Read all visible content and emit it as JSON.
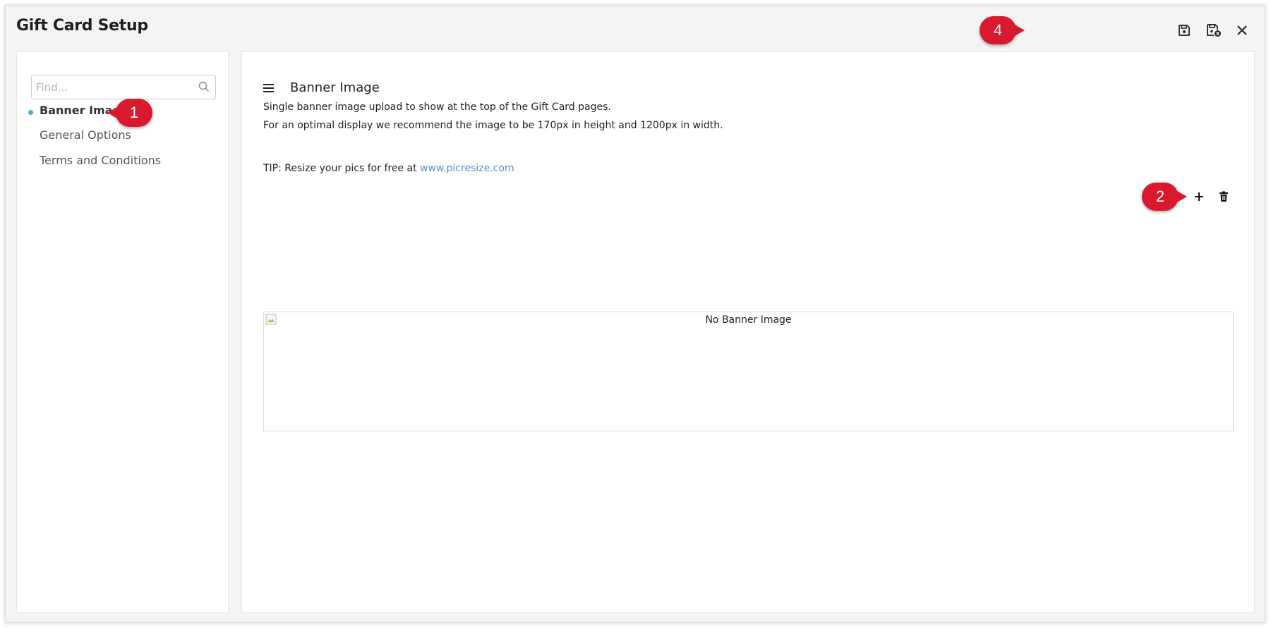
{
  "window": {
    "title": "Gift Card Setup",
    "actions": {
      "save_icon": "save-icon",
      "save_cancel_icon": "save-cancel-icon",
      "close_icon": "close-icon"
    }
  },
  "callouts": {
    "sidebar": "1",
    "add": "2",
    "save": "4"
  },
  "sidebar": {
    "search": {
      "placeholder": "Find...",
      "value": ""
    },
    "items": [
      {
        "label": "Banner Image",
        "active": true
      },
      {
        "label": "General Options",
        "active": false
      },
      {
        "label": "Terms and Conditions",
        "active": false
      }
    ]
  },
  "main": {
    "section_title": "Banner Image",
    "description_lines": [
      "Single banner image upload to show at the top of the Gift Card pages.",
      "For an optimal display we recommend the image to be 170px in height and 1200px in width."
    ],
    "tip": {
      "prefix": "TIP: Resize your pics for free at",
      "link_text": "www.picresize.com"
    },
    "banner": {
      "alt_text": "No Banner Image"
    }
  },
  "colors": {
    "callout": "#d8192e",
    "active_dot": "#3fb7c9",
    "link": "#4f8fcf"
  }
}
